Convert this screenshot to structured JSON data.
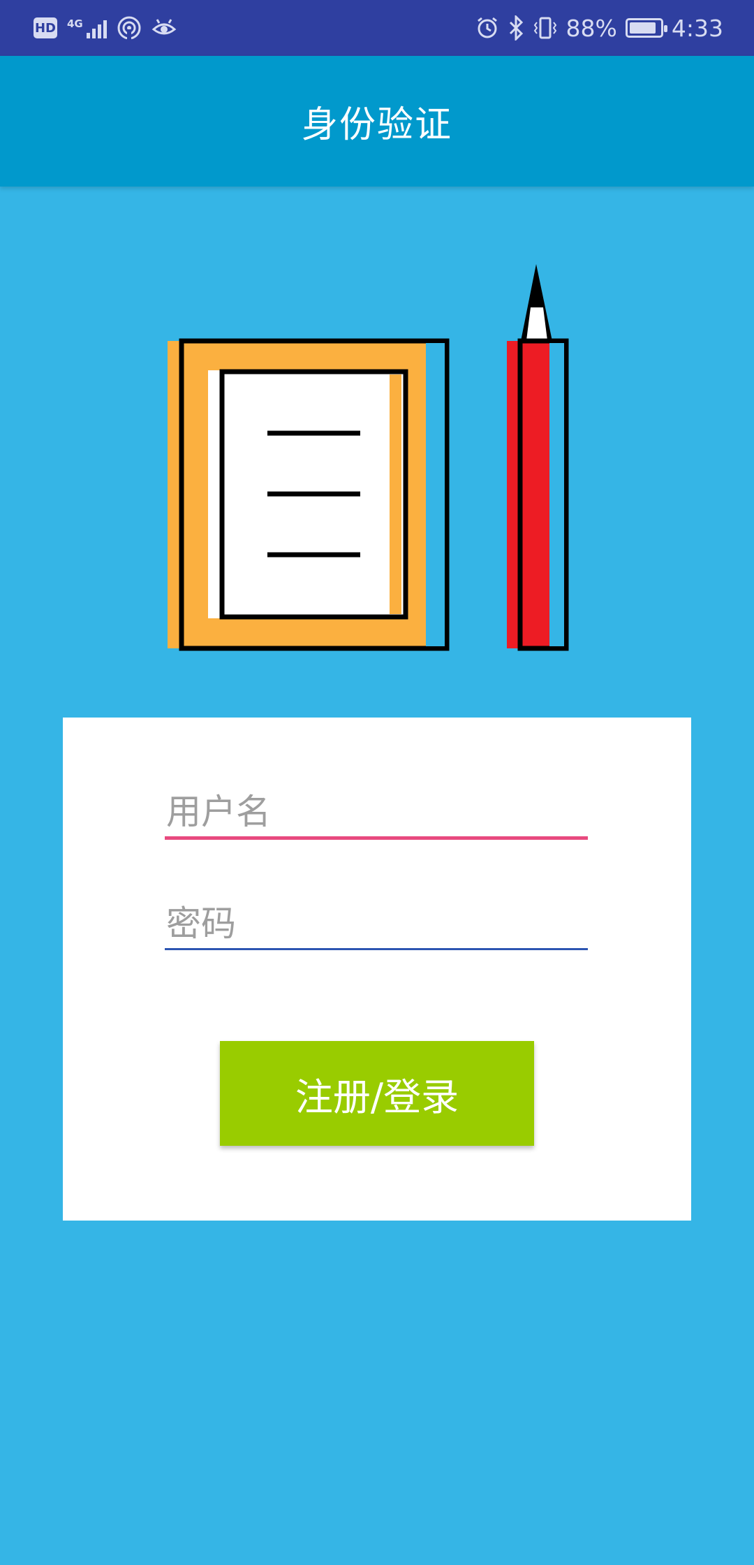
{
  "status_bar": {
    "network": "4G",
    "battery": "88%",
    "battery_level": 0.88,
    "time": "4:33",
    "left_icons": [
      "hd-icon",
      "signal-icon",
      "hotspot-icon",
      "eye-icon"
    ],
    "right_icons": [
      "alarm-icon",
      "bluetooth-icon",
      "vibrate-icon",
      "battery-icon"
    ]
  },
  "toolbar": {
    "title": "身份验证"
  },
  "illustration": {
    "icons": [
      "notebook-icon",
      "pencil-icon"
    ],
    "colors": {
      "notebook_cover": "#fbb040",
      "pencil_body": "#ed1c24",
      "outline": "#000000"
    }
  },
  "form": {
    "username_placeholder": "用户名",
    "username_value": "",
    "password_placeholder": "密码",
    "password_value": "",
    "submit_label": "注册/登录"
  },
  "colors": {
    "background": "#35b5e6",
    "toolbar": "#0199cc",
    "status_bar": "#2f3fa0",
    "accent_underline": "#e84a7f",
    "secondary_underline": "#2d55b2",
    "button": "#99cc00"
  }
}
